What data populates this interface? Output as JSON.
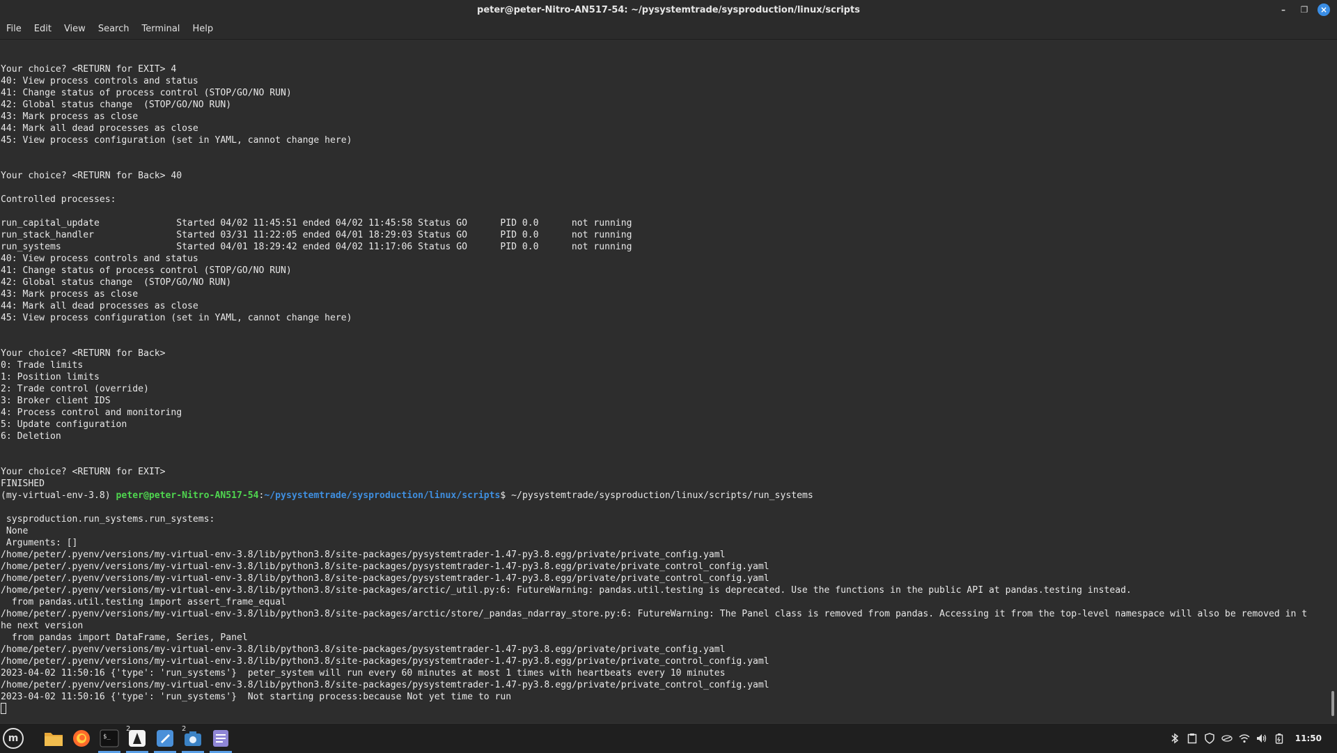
{
  "window": {
    "title": "peter@peter-Nitro-AN517-54: ~/pysystemtrade/sysproduction/linux/scripts",
    "controls": {
      "minimize": "–",
      "maximize": "❐",
      "close": "×"
    }
  },
  "menubar": {
    "items": [
      "File",
      "Edit",
      "View",
      "Search",
      "Terminal",
      "Help"
    ]
  },
  "terminal": {
    "lines": [
      "",
      "",
      "Your choice? <RETURN for EXIT> 4",
      "40: View process controls and status",
      "41: Change status of process control (STOP/GO/NO RUN)",
      "42: Global status change  (STOP/GO/NO RUN)",
      "43: Mark process as close",
      "44: Mark all dead processes as close",
      "45: View process configuration (set in YAML, cannot change here)",
      "",
      "",
      "Your choice? <RETURN for Back> 40",
      "",
      "Controlled processes:",
      "",
      "run_capital_update              Started 04/02 11:45:51 ended 04/02 11:45:58 Status GO      PID 0.0      not running",
      "run_stack_handler               Started 03/31 11:22:05 ended 04/01 18:29:03 Status GO      PID 0.0      not running",
      "run_systems                     Started 04/01 18:29:42 ended 04/02 11:17:06 Status GO      PID 0.0      not running",
      "40: View process controls and status",
      "41: Change status of process control (STOP/GO/NO RUN)",
      "42: Global status change  (STOP/GO/NO RUN)",
      "43: Mark process as close",
      "44: Mark all dead processes as close",
      "45: View process configuration (set in YAML, cannot change here)",
      "",
      "",
      "Your choice? <RETURN for Back>",
      "0: Trade limits",
      "1: Position limits",
      "2: Trade control (override)",
      "3: Broker client IDS",
      "4: Process control and monitoring",
      "5: Update configuration",
      "6: Deletion",
      "",
      "",
      "Your choice? <RETURN for EXIT>",
      "FINISHED"
    ],
    "prompt": {
      "env": "(my-virtual-env-3.8) ",
      "user_host": "peter@peter-Nitro-AN517-54",
      "sep": ":",
      "path": "~/pysystemtrade/sysproduction/linux/scripts",
      "symbol": "$ ",
      "command": "~/pysystemtrade/sysproduction/linux/scripts/run_systems"
    },
    "output_lines": [
      "",
      " sysproduction.run_systems.run_systems:",
      " None",
      " Arguments: []",
      "/home/peter/.pyenv/versions/my-virtual-env-3.8/lib/python3.8/site-packages/pysystemtrader-1.47-py3.8.egg/private/private_config.yaml",
      "/home/peter/.pyenv/versions/my-virtual-env-3.8/lib/python3.8/site-packages/pysystemtrader-1.47-py3.8.egg/private/private_control_config.yaml",
      "/home/peter/.pyenv/versions/my-virtual-env-3.8/lib/python3.8/site-packages/pysystemtrader-1.47-py3.8.egg/private/private_control_config.yaml",
      "/home/peter/.pyenv/versions/my-virtual-env-3.8/lib/python3.8/site-packages/arctic/_util.py:6: FutureWarning: pandas.util.testing is deprecated. Use the functions in the public API at pandas.testing instead.",
      "  from pandas.util.testing import assert_frame_equal",
      "/home/peter/.pyenv/versions/my-virtual-env-3.8/lib/python3.8/site-packages/arctic/store/_pandas_ndarray_store.py:6: FutureWarning: The Panel class is removed from pandas. Accessing it from the top-level namespace will also be removed in t",
      "he next version",
      "  from pandas import DataFrame, Series, Panel",
      "/home/peter/.pyenv/versions/my-virtual-env-3.8/lib/python3.8/site-packages/pysystemtrader-1.47-py3.8.egg/private/private_config.yaml",
      "/home/peter/.pyenv/versions/my-virtual-env-3.8/lib/python3.8/site-packages/pysystemtrader-1.47-py3.8.egg/private/private_control_config.yaml",
      "2023-04-02 11:50:16 {'type': 'run_systems'}  peter_system will run every 60 minutes at most 1 times with heartbeats every 10 minutes",
      "/home/peter/.pyenv/versions/my-virtual-env-3.8/lib/python3.8/site-packages/pysystemtrader-1.47-py3.8.egg/private/private_control_config.yaml",
      "2023-04-02 11:50:16 {'type': 'run_systems'}  Not starting process:because Not yet time to run"
    ]
  },
  "taskbar": {
    "start_label": "m",
    "apps": [
      {
        "name": "file-manager-icon",
        "badge": ""
      },
      {
        "name": "firefox-icon",
        "badge": ""
      },
      {
        "name": "terminal-icon",
        "badge": ""
      },
      {
        "name": "inkscape-icon",
        "badge": "2"
      },
      {
        "name": "text-editor-icon",
        "badge": ""
      },
      {
        "name": "screenshot-icon",
        "badge": "2"
      },
      {
        "name": "notes-icon",
        "badge": ""
      }
    ],
    "clock": "11:50"
  }
}
